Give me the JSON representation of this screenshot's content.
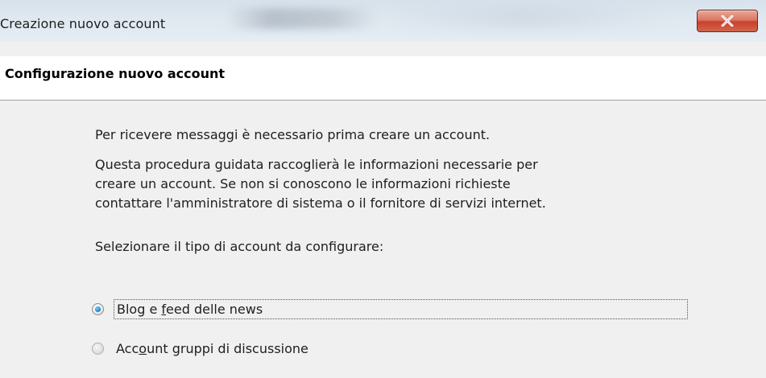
{
  "window": {
    "title": "Creazione nuovo account",
    "close_label": "X"
  },
  "header": {
    "title": "Configurazione nuovo account"
  },
  "body": {
    "intro": "Per ricevere messaggi è necessario prima creare un account.",
    "description_lines": [
      "Questa procedura guidata raccoglierà le informazioni necessarie per",
      "creare un account. Se non si conoscono le informazioni richieste",
      "contattare l'amministratore di sistema o il fornitore di servizi internet."
    ],
    "select_prompt": "Selezionare il tipo di account da configurare:"
  },
  "options": [
    {
      "label_pre": "Blog e ",
      "label_access": "f",
      "label_post": "eed delle news",
      "selected": true
    },
    {
      "label_pre": "Acc",
      "label_access": "o",
      "label_post": "unt gruppi di discussione",
      "selected": false
    }
  ]
}
